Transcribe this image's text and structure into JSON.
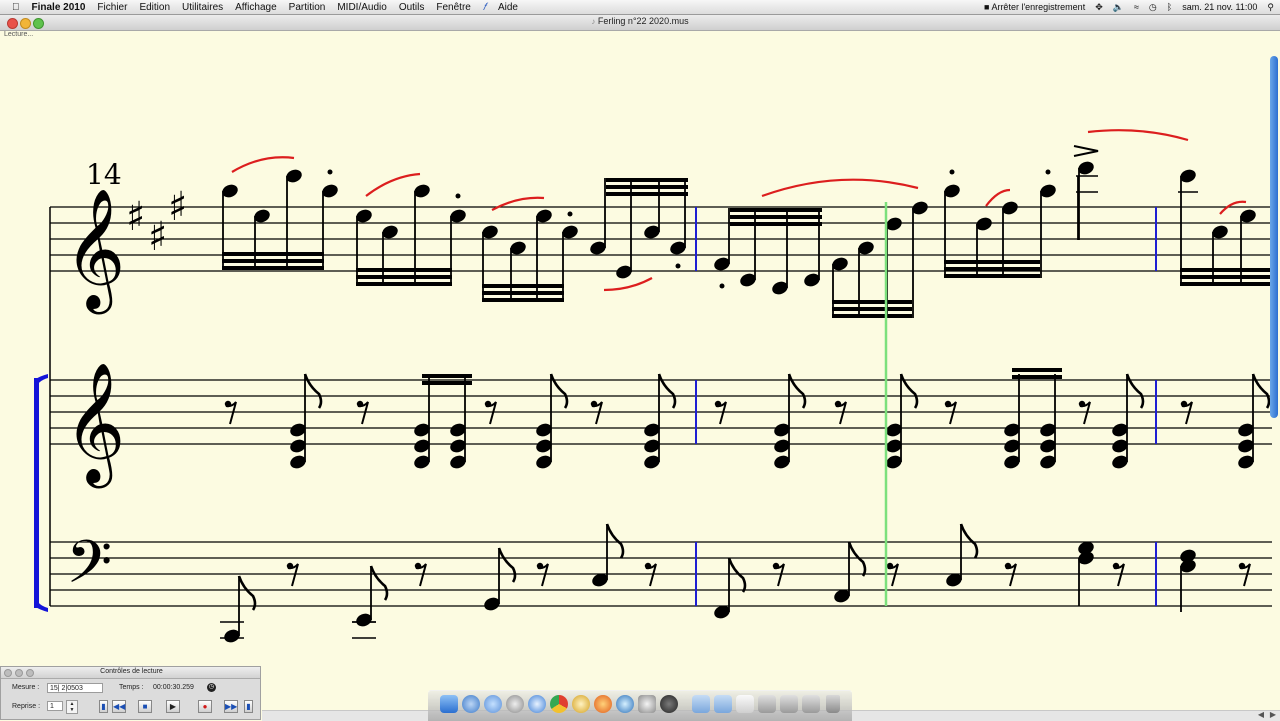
{
  "menubar": {
    "apple_icon": "apple-icon",
    "app_name": "Finale 2010",
    "items": [
      "Fichier",
      "Edition",
      "Utilitaires",
      "Affichage",
      "Partition",
      "MIDI/Audio",
      "Outils",
      "Fenêtre"
    ],
    "help": "Aide",
    "record_stop": "Arrêter l'enregistrement",
    "date_time": "sam. 21 nov.  11:00"
  },
  "window": {
    "title": "Ferling n°22 2020.mus",
    "status": "Lecture..."
  },
  "score": {
    "measure_number": "14",
    "colors": {
      "slur": "#DC1E1E",
      "barline": "#1E1ED2",
      "playback_cursor": "#7CE07C",
      "bracket": "#1414D8",
      "note": "#000000"
    }
  },
  "playback": {
    "title": "Contrôles de lecture",
    "measure_label": "Mesure :",
    "measure_value": "15| 2|0503",
    "time_label": "Temps :",
    "time_value": "00:00:30.259",
    "repeat_label": "Reprise :",
    "repeat_value": "1"
  }
}
